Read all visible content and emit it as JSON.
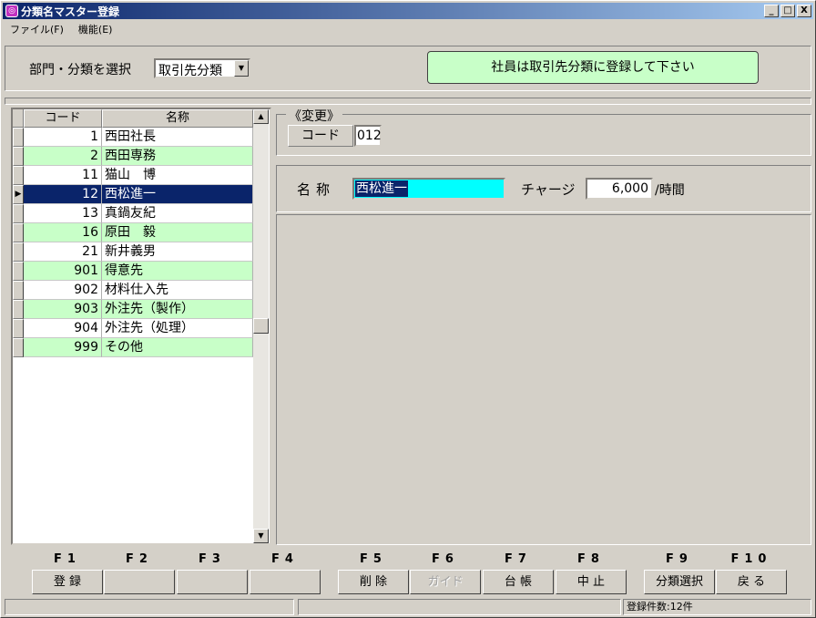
{
  "window": {
    "title": "分類名マスター登録",
    "icon_char": "◎",
    "controls": [
      "_",
      "□",
      "X"
    ]
  },
  "menu": [
    "ファイル(F)",
    "機能(E)"
  ],
  "selector": {
    "label": "部門・分類を選択",
    "value": "取引先分類",
    "notice": "社員は取引先分類に登録して下さい"
  },
  "grid": {
    "headers": [
      "コード",
      "名称"
    ],
    "rows": [
      {
        "code": "1",
        "name": "西田社長"
      },
      {
        "code": "2",
        "name": "西田専務"
      },
      {
        "code": "11",
        "name": "猫山　博"
      },
      {
        "code": "12",
        "name": "西松進一"
      },
      {
        "code": "13",
        "name": "真鍋友紀"
      },
      {
        "code": "16",
        "name": "原田　毅"
      },
      {
        "code": "21",
        "name": "新井義男"
      },
      {
        "code": "901",
        "name": "得意先"
      },
      {
        "code": "902",
        "name": "材料仕入先"
      },
      {
        "code": "903",
        "name": "外注先（製作）"
      },
      {
        "code": "904",
        "name": "外注先（処理）"
      },
      {
        "code": "999",
        "name": "その他"
      }
    ],
    "selected_index": 3
  },
  "change": {
    "group_title": "《変更》",
    "code_label": "コード",
    "code_value": "012"
  },
  "detail": {
    "name_label": "名称",
    "name_value": "西松進一",
    "charge_label": "チャージ",
    "charge_value": "6,000",
    "charge_unit": "/時間"
  },
  "fkeys": [
    {
      "key": "F1",
      "label": "登 録",
      "enabled": true
    },
    {
      "key": "F2",
      "label": "",
      "enabled": true
    },
    {
      "key": "F3",
      "label": "",
      "enabled": true
    },
    {
      "key": "F4",
      "label": "",
      "enabled": true
    },
    {
      "key": "F5",
      "label": "削 除",
      "enabled": true
    },
    {
      "key": "F6",
      "label": "ガイド",
      "enabled": false
    },
    {
      "key": "F7",
      "label": "台 帳",
      "enabled": true
    },
    {
      "key": "F8",
      "label": "中 止",
      "enabled": true
    },
    {
      "key": "F9",
      "label": "分類選択",
      "enabled": true
    },
    {
      "key": "F10",
      "label": "戻 る",
      "enabled": true
    }
  ],
  "status": {
    "panel1": "",
    "panel2": "",
    "count_text": "登録件数:12件"
  },
  "colors": {
    "row_green": "#c8ffc8",
    "selected_row": "#0a246a",
    "name_field": "#00ffff",
    "notice_bg": "#c8ffc8"
  }
}
